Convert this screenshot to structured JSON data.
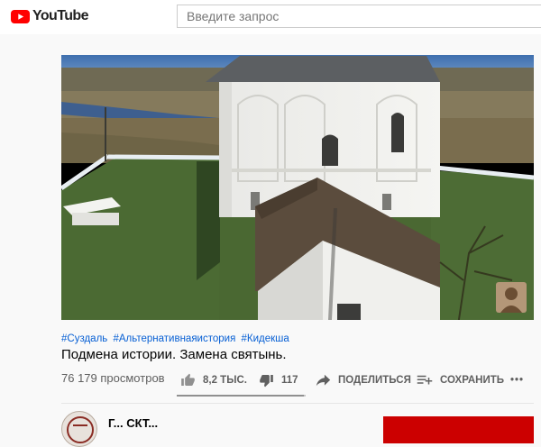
{
  "header": {
    "logo_text": "YouTube",
    "search_placeholder": "Введите запрос"
  },
  "video": {
    "hashtags": [
      "#Суздаль",
      "#Альтернативнаяистория",
      "#Кидекша"
    ],
    "title": "Подмена истории. Замена святынь.",
    "views": "76 179 просмотров",
    "likes": "8,2 ТЫС.",
    "dislikes": "117",
    "like_ratio": 0.986,
    "share_label": "ПОДЕЛИТЬСЯ",
    "save_label": "СОХРАНИТЬ",
    "more_label": "•••"
  },
  "channel": {
    "name": "Г... СКТ..."
  },
  "colors": {
    "brand_red": "#ff0000",
    "link_blue": "#065fd4",
    "subscribe_red": "#cc0000"
  }
}
